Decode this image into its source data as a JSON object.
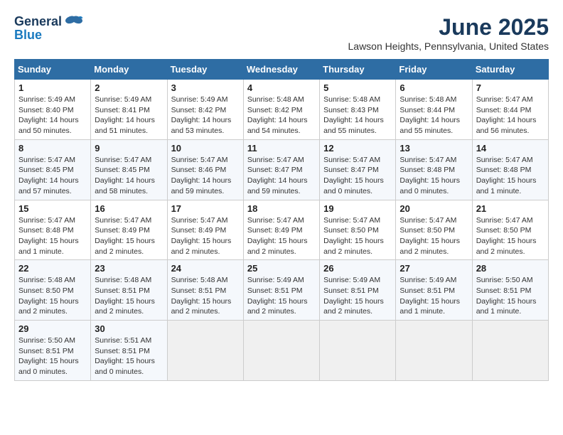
{
  "header": {
    "logo_line1": "General",
    "logo_line2": "Blue",
    "title": "June 2025",
    "subtitle": "Lawson Heights, Pennsylvania, United States"
  },
  "calendar": {
    "days_of_week": [
      "Sunday",
      "Monday",
      "Tuesday",
      "Wednesday",
      "Thursday",
      "Friday",
      "Saturday"
    ],
    "weeks": [
      [
        {
          "day": "1",
          "sunrise": "5:49 AM",
          "sunset": "8:40 PM",
          "daylight": "14 hours and 50 minutes."
        },
        {
          "day": "2",
          "sunrise": "5:49 AM",
          "sunset": "8:41 PM",
          "daylight": "14 hours and 51 minutes."
        },
        {
          "day": "3",
          "sunrise": "5:49 AM",
          "sunset": "8:42 PM",
          "daylight": "14 hours and 53 minutes."
        },
        {
          "day": "4",
          "sunrise": "5:48 AM",
          "sunset": "8:42 PM",
          "daylight": "14 hours and 54 minutes."
        },
        {
          "day": "5",
          "sunrise": "5:48 AM",
          "sunset": "8:43 PM",
          "daylight": "14 hours and 55 minutes."
        },
        {
          "day": "6",
          "sunrise": "5:48 AM",
          "sunset": "8:44 PM",
          "daylight": "14 hours and 55 minutes."
        },
        {
          "day": "7",
          "sunrise": "5:47 AM",
          "sunset": "8:44 PM",
          "daylight": "14 hours and 56 minutes."
        }
      ],
      [
        {
          "day": "8",
          "sunrise": "5:47 AM",
          "sunset": "8:45 PM",
          "daylight": "14 hours and 57 minutes."
        },
        {
          "day": "9",
          "sunrise": "5:47 AM",
          "sunset": "8:45 PM",
          "daylight": "14 hours and 58 minutes."
        },
        {
          "day": "10",
          "sunrise": "5:47 AM",
          "sunset": "8:46 PM",
          "daylight": "14 hours and 59 minutes."
        },
        {
          "day": "11",
          "sunrise": "5:47 AM",
          "sunset": "8:47 PM",
          "daylight": "14 hours and 59 minutes."
        },
        {
          "day": "12",
          "sunrise": "5:47 AM",
          "sunset": "8:47 PM",
          "daylight": "15 hours and 0 minutes."
        },
        {
          "day": "13",
          "sunrise": "5:47 AM",
          "sunset": "8:48 PM",
          "daylight": "15 hours and 0 minutes."
        },
        {
          "day": "14",
          "sunrise": "5:47 AM",
          "sunset": "8:48 PM",
          "daylight": "15 hours and 1 minute."
        }
      ],
      [
        {
          "day": "15",
          "sunrise": "5:47 AM",
          "sunset": "8:48 PM",
          "daylight": "15 hours and 1 minute."
        },
        {
          "day": "16",
          "sunrise": "5:47 AM",
          "sunset": "8:49 PM",
          "daylight": "15 hours and 2 minutes."
        },
        {
          "day": "17",
          "sunrise": "5:47 AM",
          "sunset": "8:49 PM",
          "daylight": "15 hours and 2 minutes."
        },
        {
          "day": "18",
          "sunrise": "5:47 AM",
          "sunset": "8:49 PM",
          "daylight": "15 hours and 2 minutes."
        },
        {
          "day": "19",
          "sunrise": "5:47 AM",
          "sunset": "8:50 PM",
          "daylight": "15 hours and 2 minutes."
        },
        {
          "day": "20",
          "sunrise": "5:47 AM",
          "sunset": "8:50 PM",
          "daylight": "15 hours and 2 minutes."
        },
        {
          "day": "21",
          "sunrise": "5:47 AM",
          "sunset": "8:50 PM",
          "daylight": "15 hours and 2 minutes."
        }
      ],
      [
        {
          "day": "22",
          "sunrise": "5:48 AM",
          "sunset": "8:50 PM",
          "daylight": "15 hours and 2 minutes."
        },
        {
          "day": "23",
          "sunrise": "5:48 AM",
          "sunset": "8:51 PM",
          "daylight": "15 hours and 2 minutes."
        },
        {
          "day": "24",
          "sunrise": "5:48 AM",
          "sunset": "8:51 PM",
          "daylight": "15 hours and 2 minutes."
        },
        {
          "day": "25",
          "sunrise": "5:49 AM",
          "sunset": "8:51 PM",
          "daylight": "15 hours and 2 minutes."
        },
        {
          "day": "26",
          "sunrise": "5:49 AM",
          "sunset": "8:51 PM",
          "daylight": "15 hours and 2 minutes."
        },
        {
          "day": "27",
          "sunrise": "5:49 AM",
          "sunset": "8:51 PM",
          "daylight": "15 hours and 1 minute."
        },
        {
          "day": "28",
          "sunrise": "5:50 AM",
          "sunset": "8:51 PM",
          "daylight": "15 hours and 1 minute."
        }
      ],
      [
        {
          "day": "29",
          "sunrise": "5:50 AM",
          "sunset": "8:51 PM",
          "daylight": "15 hours and 0 minutes."
        },
        {
          "day": "30",
          "sunrise": "5:51 AM",
          "sunset": "8:51 PM",
          "daylight": "15 hours and 0 minutes."
        },
        null,
        null,
        null,
        null,
        null
      ]
    ]
  }
}
